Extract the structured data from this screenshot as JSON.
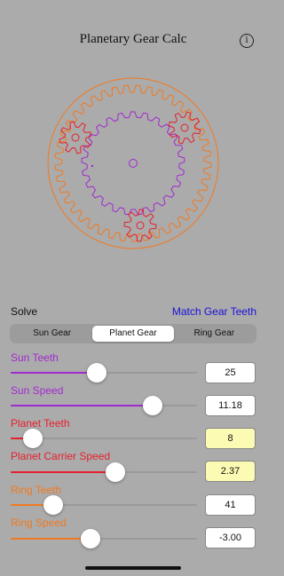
{
  "header": {
    "title": "Planetary Gear Calc",
    "info_icon": "info-icon",
    "info_glyph": "i"
  },
  "solve": {
    "label": "Solve",
    "match_button": "Match Gear Teeth"
  },
  "segments": {
    "items": [
      "Sun Gear",
      "Planet Gear",
      "Ring Gear"
    ],
    "selected": "Planet Gear"
  },
  "colors": {
    "sun": "#a12ad0",
    "planet": "#e5202e",
    "ring": "#f07a22",
    "background": "#ababab",
    "highlight_box": "#fbfbb4",
    "link": "#1a10d8"
  },
  "parameters": [
    {
      "label": "Sun Teeth",
      "value": "25",
      "slider_fraction": 0.46,
      "color": "#a12ad0",
      "computed": false
    },
    {
      "label": "Sun Speed",
      "value": "11.18",
      "slider_fraction": 0.76,
      "color": "#a12ad0",
      "computed": false
    },
    {
      "label": "Planet Teeth",
      "value": "8",
      "slider_fraction": 0.12,
      "color": "#e5202e",
      "computed": true
    },
    {
      "label": "Planet Carrier Speed",
      "value": "2.37",
      "slider_fraction": 0.56,
      "color": "#e5202e",
      "computed": true
    },
    {
      "label": "Ring Teeth",
      "value": "41",
      "slider_fraction": 0.23,
      "color": "#f07a22",
      "computed": false
    },
    {
      "label": "Ring Speed",
      "value": "-3.00",
      "slider_fraction": 0.43,
      "color": "#f07a22",
      "computed": false
    }
  ],
  "diagram": {
    "sun_teeth": 25,
    "planet_teeth": 8,
    "ring_teeth": 41,
    "planet_count": 3
  }
}
